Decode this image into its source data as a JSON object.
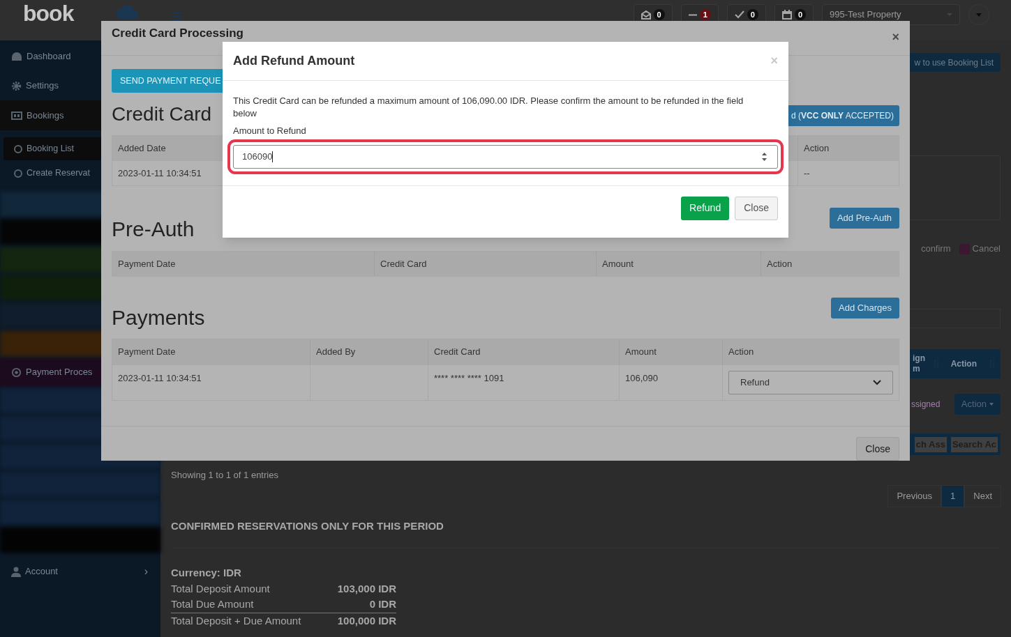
{
  "header": {
    "logo": "book",
    "badges": [
      {
        "count": "0",
        "color": "#111111"
      },
      {
        "count": "1",
        "color": "#6a0f16"
      },
      {
        "count": "0",
        "color": "#111111"
      },
      {
        "count": "0",
        "color": "#111111"
      }
    ],
    "property_select": "995-Test Property"
  },
  "sidebar": {
    "items": [
      {
        "kind": "item",
        "label": "Dashboard",
        "selected": false
      },
      {
        "kind": "item",
        "label": "Settings",
        "selected": false
      },
      {
        "kind": "section",
        "label": "Bookings",
        "selected": true,
        "children": [
          {
            "label": "Booking List",
            "selected": true
          },
          {
            "label": "Create Reservat",
            "selected": false
          }
        ]
      },
      {
        "kind": "blur",
        "color": "#10283a"
      },
      {
        "kind": "blur",
        "color": "#050505"
      },
      {
        "kind": "blur",
        "color": "#14260f"
      },
      {
        "kind": "blur",
        "color": "#0f1f0c"
      },
      {
        "kind": "blur",
        "color": "#101d2c"
      },
      {
        "kind": "blur",
        "color": "#3a2208"
      },
      {
        "kind": "band",
        "label": "Payment Proces",
        "selected": false,
        "color": "#1c0b1e"
      },
      {
        "kind": "blur",
        "color": "#10233a"
      },
      {
        "kind": "blur",
        "color": "#10233a"
      },
      {
        "kind": "blur",
        "color": "#10233a"
      },
      {
        "kind": "blur",
        "color": "#10233a"
      },
      {
        "kind": "blur",
        "color": "#10233a"
      },
      {
        "kind": "blur",
        "color": "#030303"
      },
      {
        "kind": "item",
        "label": "Account",
        "selected": false,
        "chevron": "›"
      }
    ]
  },
  "background": {
    "help_button": "w to use Booking List",
    "legend": [
      {
        "label": "confirm"
      },
      {
        "label": "Cancel",
        "color": "#3b1830"
      }
    ],
    "table_head": {
      "partial_column": "ign m",
      "action": "Action"
    },
    "assigned_text": "ssigned",
    "action_button": "Action",
    "search_fields": [
      "ch Ass",
      "Search Ac"
    ],
    "entries_info": "Showing 1 to 1 of 1 entries",
    "pagination": [
      {
        "label": "Previous",
        "selected": false
      },
      {
        "label": "1",
        "selected": true
      },
      {
        "label": "Next",
        "selected": false
      }
    ],
    "summary_title": "CONFIRMED RESERVATIONS ONLY FOR THIS PERIOD",
    "currency": "Currency: IDR",
    "totals": [
      {
        "label": "Total Deposit Amount",
        "value": "103,000 IDR"
      },
      {
        "label": "Total Due Amount",
        "value": "0 IDR"
      },
      {
        "label": "Total Deposit + Due Amount",
        "value": "100,000 IDR"
      }
    ]
  },
  "cc_modal": {
    "title": "Credit Card Processing",
    "close": "×",
    "send_button": "SEND PAYMENT REQUE",
    "credit_cards": {
      "heading": "Credit Card",
      "add_button": "d (**VCC ONLY** ACCEPTED)",
      "columns": [
        "Added Date",
        "Action"
      ],
      "row": [
        "2023-01-11 10:34:51",
        "--"
      ]
    },
    "pre_auth": {
      "heading": "Pre-Auth",
      "add_button": "Add Pre-Auth",
      "columns": [
        "Payment Date",
        "Credit Card",
        "Amount",
        "Action"
      ]
    },
    "payments": {
      "heading": "Payments",
      "add_button": "Add Charges",
      "columns": [
        "Payment Date",
        "Added By",
        "Credit Card",
        "Amount",
        "Action"
      ],
      "row": {
        "payment_date": "2023-01-11 10:34:51",
        "credit_card": "**** **** **** 1091",
        "amount": "106,090"
      },
      "action_select": "Refund"
    },
    "footer_button": "Close"
  },
  "refund_modal": {
    "title": "Add Refund Amount",
    "close": "×",
    "message": "This Credit Card can be refunded a maximum amount of 106,090.00 IDR. Please confirm the amount to be refunded in the field below",
    "label": "Amount to Refund",
    "value": "106090",
    "focused": true,
    "refund_button": "Refund",
    "close_button": "Close"
  }
}
